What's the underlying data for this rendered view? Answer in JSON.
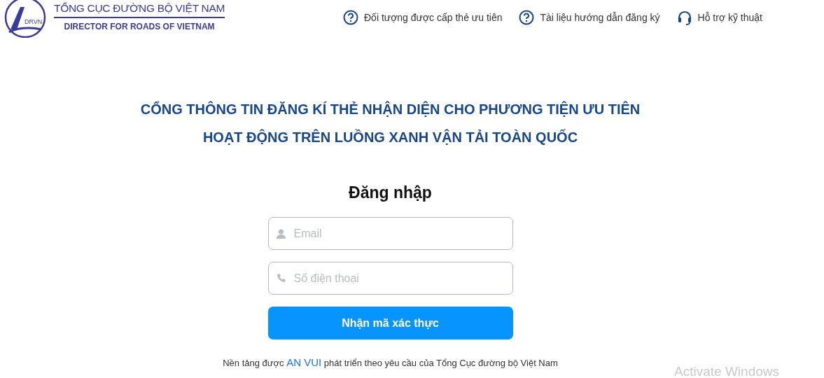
{
  "header": {
    "logo": {
      "badge": "DRVN",
      "title": "TỔNG CỤC ĐƯỜNG BỘ VIỆT NAM",
      "subtitle": "DIRECTOR FOR ROADS OF VIETNAM"
    },
    "nav": [
      {
        "kind": "help",
        "label": "Đối tượng được cấp thẻ ưu tiên"
      },
      {
        "kind": "help",
        "label": "Tài liệu hướng dẫn đăng ký"
      },
      {
        "kind": "support",
        "label": "Hỗ trợ kỹ thuật"
      }
    ]
  },
  "headline": [
    "CỔNG THÔNG TIN ĐĂNG KÍ THẺ NHẬN DIỆN CHO PHƯƠNG TIỆN ƯU TIÊN",
    "HOẠT ĐỘNG TRÊN LUỒNG XANH VẬN TẢI TOÀN QUỐC"
  ],
  "login": {
    "title": "Đăng nhập",
    "fields": [
      {
        "kind": "person",
        "placeholder": "Email"
      },
      {
        "kind": "phone",
        "placeholder": "Số điện thoại"
      }
    ],
    "submit": "Nhận mã xác thực"
  },
  "footer": {
    "before": "Nền tảng được",
    "link": "AN VUI",
    "after": "phát triển theo yêu cầu của Tổng Cục đường bộ Việt Nam"
  },
  "os_overlay": "Activate Windows"
}
